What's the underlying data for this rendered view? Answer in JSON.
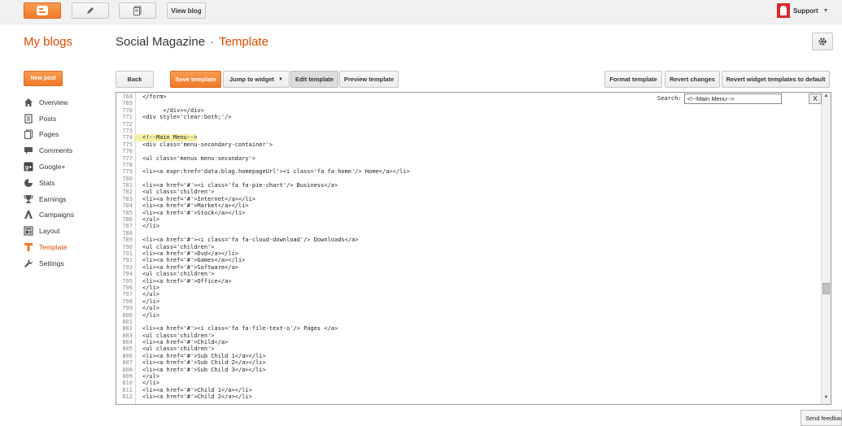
{
  "topbar": {
    "view_blog": "View blog",
    "account": "Support"
  },
  "header": {
    "my_blogs": "My blogs",
    "blog_name": "Social Magazine",
    "separator": "·",
    "page_name": "Template"
  },
  "sidebar": {
    "new_post": "New post",
    "items": [
      {
        "label": "Overview",
        "icon": "home-icon"
      },
      {
        "label": "Posts",
        "icon": "posts-icon"
      },
      {
        "label": "Pages",
        "icon": "pages-icon"
      },
      {
        "label": "Comments",
        "icon": "comments-icon"
      },
      {
        "label": "Google+",
        "icon": "google-plus-icon"
      },
      {
        "label": "Stats",
        "icon": "stats-icon"
      },
      {
        "label": "Earnings",
        "icon": "trophy-icon"
      },
      {
        "label": "Campaigns",
        "icon": "adwords-icon"
      },
      {
        "label": "Layout",
        "icon": "layout-icon"
      },
      {
        "label": "Template",
        "icon": "template-icon"
      },
      {
        "label": "Settings",
        "icon": "wrench-icon"
      }
    ],
    "active": "Template"
  },
  "toolbar": {
    "back": "Back",
    "save": "Save template",
    "jump": "Jump to widget",
    "edit": "Edit template",
    "preview": "Preview template",
    "format": "Format template",
    "revert": "Revert changes",
    "revert_widgets": "Revert widget templates to default"
  },
  "search": {
    "label": "Search:",
    "value": "<!--Main Menu-->",
    "close": "X"
  },
  "editor": {
    "lines": [
      {
        "n": "768",
        "t": "</form>"
      },
      {
        "n": "769",
        "t": ""
      },
      {
        "n": "770",
        "t": "      </div></div>"
      },
      {
        "n": "771",
        "t": "<div style='clear:both;'/>"
      },
      {
        "n": "772",
        "t": ""
      },
      {
        "n": "773",
        "t": ""
      },
      {
        "n": "774",
        "t": "<!--Main Menu-->",
        "hl": true
      },
      {
        "n": "775",
        "t": "<div class='menu-secondary-container'>"
      },
      {
        "n": "776",
        "t": ""
      },
      {
        "n": "777",
        "t": "<ul class='menus menu-secondary'>"
      },
      {
        "n": "778",
        "t": ""
      },
      {
        "n": "779",
        "t": "<li><a expr:href='data:blog.homepageUrl'><i class='fa fa-home'/> Home</a></li>"
      },
      {
        "n": "780",
        "t": ""
      },
      {
        "n": "781",
        "t": "<li><a href='#'><i class='fa fa-pie-chart'/> Business</a>"
      },
      {
        "n": "782",
        "t": "<ul class='children'>"
      },
      {
        "n": "783",
        "t": "<li><a href='#'>Internet</a></li>"
      },
      {
        "n": "784",
        "t": "<li><a href='#'>Market</a></li>"
      },
      {
        "n": "785",
        "t": "<li><a href='#'>Stock</a></li>"
      },
      {
        "n": "786",
        "t": "</ul>"
      },
      {
        "n": "787",
        "t": "</li>"
      },
      {
        "n": "788",
        "t": ""
      },
      {
        "n": "789",
        "t": "<li><a href='#'><i class='fa fa-cloud-download'/> Downloads</a>"
      },
      {
        "n": "790",
        "t": "<ul class='children'>"
      },
      {
        "n": "791",
        "t": "<li><a href='#'>Dvd</a></li>"
      },
      {
        "n": "792",
        "t": "<li><a href='#'>Games</a></li>"
      },
      {
        "n": "793",
        "t": "<li><a href='#'>Software</a>"
      },
      {
        "n": "794",
        "t": "<ul class='children'>"
      },
      {
        "n": "795",
        "t": "<li><a href='#'>Office</a>"
      },
      {
        "n": "796",
        "t": "</li>"
      },
      {
        "n": "797",
        "t": "</ul>"
      },
      {
        "n": "798",
        "t": "</li>"
      },
      {
        "n": "799",
        "t": "</ul>"
      },
      {
        "n": "800",
        "t": "</li>"
      },
      {
        "n": "801",
        "t": ""
      },
      {
        "n": "802",
        "t": "<li><a href='#'><i class='fa fa-file-text-o'/> Pages </a>"
      },
      {
        "n": "803",
        "t": "<ul class='children'>"
      },
      {
        "n": "804",
        "t": "<li><a href='#'>Child</a>"
      },
      {
        "n": "805",
        "t": "<ul class='children'>"
      },
      {
        "n": "806",
        "t": "<li><a href='#'>Sub Child 1</a></li>"
      },
      {
        "n": "807",
        "t": "<li><a href='#'>Sub Child 2</a></li>"
      },
      {
        "n": "808",
        "t": "<li><a href='#'>Sub Child 3</a></li>"
      },
      {
        "n": "809",
        "t": "</ul>"
      },
      {
        "n": "810",
        "t": "</li>"
      },
      {
        "n": "811",
        "t": "<li><a href='#'>Child 1</a></li>"
      },
      {
        "n": "812",
        "t": "<li><a href='#'>Child 2</a></li>"
      }
    ]
  },
  "feedback": "Send feedback",
  "colors": {
    "accent": "#dd4b00",
    "button_orange": "#f07a2b",
    "highlight": "#f6f0a4"
  }
}
